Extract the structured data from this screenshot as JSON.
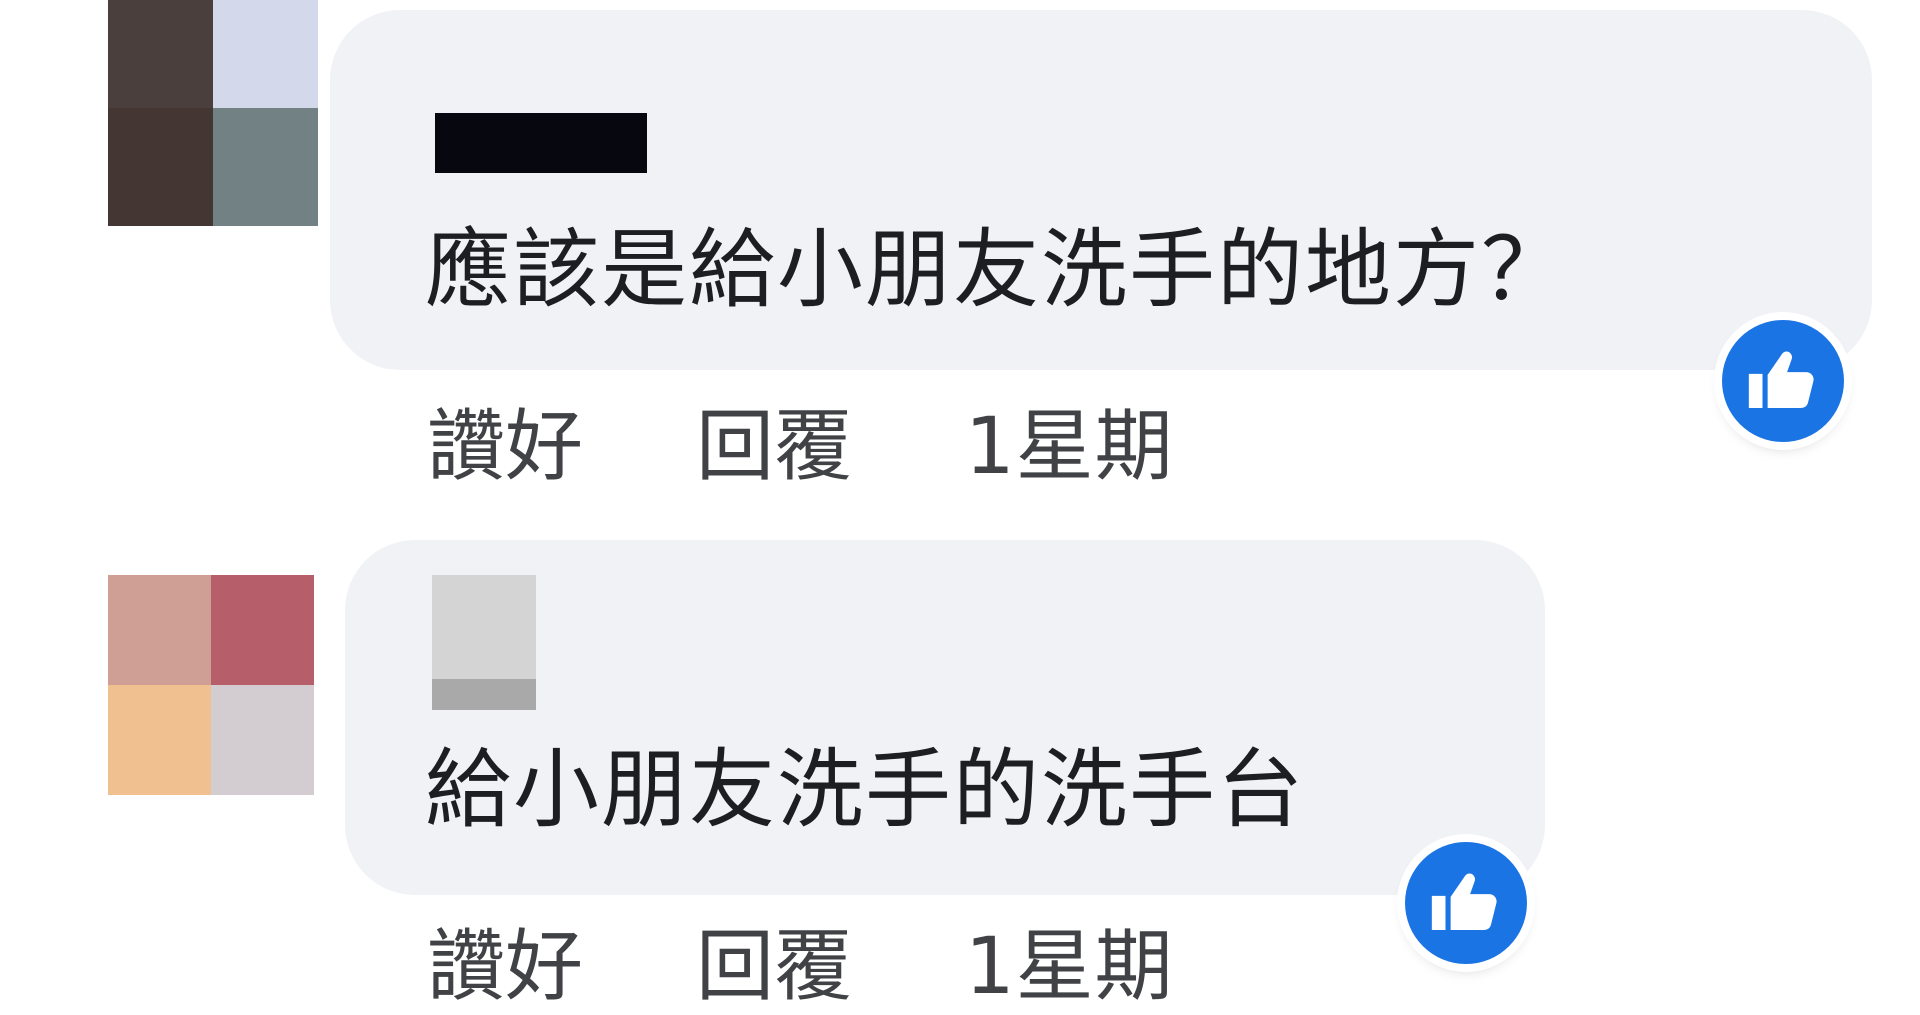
{
  "comments": [
    {
      "author": "",
      "avatar_colors": [
        "#4a3f3d",
        "#d3d9ea",
        "#433633",
        "#728183"
      ],
      "name_redaction_color": "#07070f",
      "text": "應該是給小朋友洗手的地方？",
      "reaction_icon": "like-icon",
      "actions": {
        "like": "讚好",
        "reply": "回覆",
        "time": "1星期"
      }
    },
    {
      "author": "",
      "avatar_colors": [
        "#cf9f96",
        "#b65e69",
        "#f1c091",
        "#d3cdd1"
      ],
      "name_redaction_color": "#d4d4d4",
      "text": "給小朋友洗手的洗手台",
      "reaction_icon": "like-icon",
      "actions": {
        "like": "讚好",
        "reply": "回覆",
        "time": "1星期"
      }
    }
  ],
  "colors": {
    "bubble": "#f0f2f5",
    "reaction": "#1b74e4",
    "text": "#1c1e21",
    "meta": "#404246"
  }
}
